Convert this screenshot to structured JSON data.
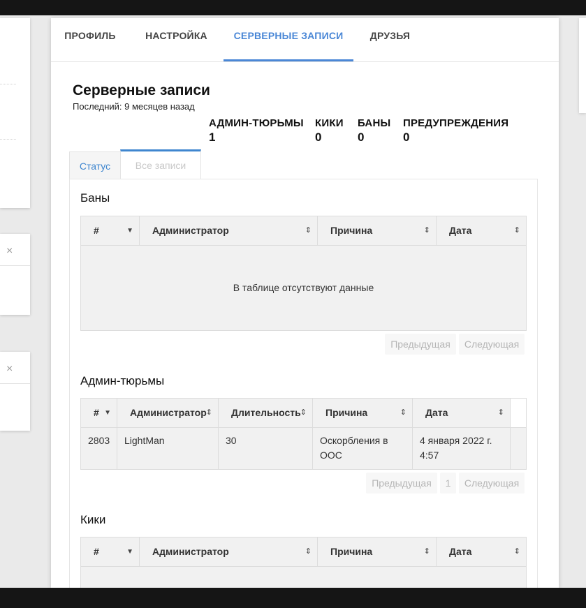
{
  "nav": {
    "tabs": [
      {
        "label": "ПРОФИЛЬ"
      },
      {
        "label": "НАСТРОЙКА"
      },
      {
        "label": "СЕРВЕРНЫЕ ЗАПИСИ"
      },
      {
        "label": "ДРУЗЬЯ"
      }
    ],
    "active_tab": "СЕРВЕРНЫЕ ЗАПИСИ",
    "accent_color": "#4a87d6"
  },
  "side_cards": {
    "close_glyph": "×"
  },
  "header": {
    "title": "Серверные записи",
    "subtitle": "Последний: 9 месяцев назад"
  },
  "stats": [
    {
      "label": "АДМИН-ТЮРЬМЫ",
      "value": "1"
    },
    {
      "label": "КИКИ",
      "value": "0"
    },
    {
      "label": "БАНЫ",
      "value": "0"
    },
    {
      "label": "ПРЕДУПРЕЖДЕНИЯ",
      "value": "0"
    }
  ],
  "subtabs": {
    "status": "Статус",
    "all": "Все записи",
    "active": "Все записи"
  },
  "bans": {
    "title": "Баны",
    "columns": [
      "#",
      "Администратор",
      "Причина",
      "Дата"
    ],
    "empty": "В таблице отсутствуют данные",
    "prev": "Предыдущая",
    "next": "Следующая"
  },
  "jails": {
    "title": "Админ-тюрьмы",
    "columns": [
      "#",
      "Администратор",
      "Длительность",
      "Причина",
      "Дата"
    ],
    "rows": [
      {
        "id": "2803",
        "admin": "LightMan",
        "duration": "30",
        "reason": "Оскорбления в ООС",
        "date": "4 января 2022 г. 4:57"
      }
    ],
    "prev": "Предыдущая",
    "page": "1",
    "next": "Следующая"
  },
  "kicks": {
    "title": "Кики",
    "columns": [
      "#",
      "Администратор",
      "Причина",
      "Дата"
    ]
  },
  "icons": {
    "sort": "sort-both-icon",
    "sort_desc": "caret-down-icon",
    "close": "close-icon"
  }
}
